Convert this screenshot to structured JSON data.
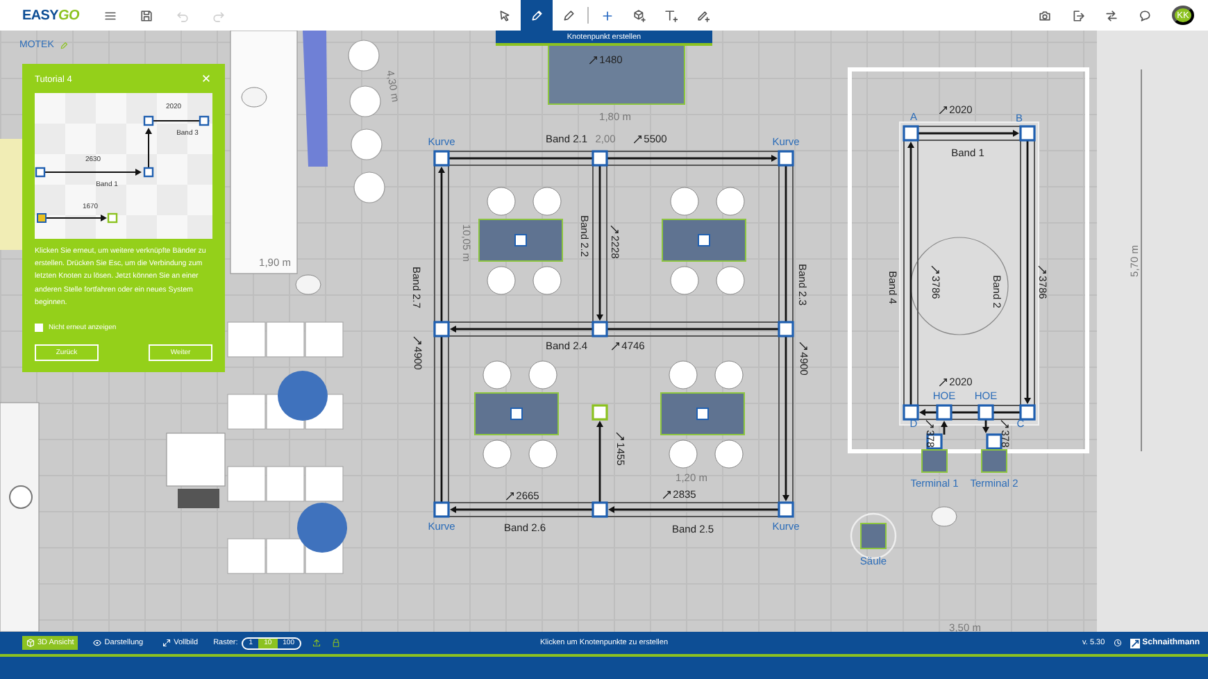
{
  "toolbar": {
    "logo": [
      "EASY",
      "GO"
    ],
    "history": [
      {
        "kind": "undo",
        "disabled": true
      },
      {
        "kind": "redo",
        "disabled": true
      }
    ],
    "tools": [
      {
        "kind": "select",
        "selected": false
      },
      {
        "kind": "draw",
        "selected": true
      },
      {
        "kind": "edit",
        "selected": false
      },
      {
        "kind": "add_node",
        "selected": false
      },
      {
        "kind": "add_object",
        "selected": false
      },
      {
        "kind": "add_text",
        "selected": false
      },
      {
        "kind": "add_dimension",
        "selected": false
      }
    ],
    "tooltip": "Knotenpunkt erstellen",
    "actions": [
      {
        "kind": "camera"
      },
      {
        "kind": "export"
      },
      {
        "kind": "switch"
      },
      {
        "kind": "chat"
      }
    ],
    "user": {
      "initials": "KK"
    }
  },
  "canvas": {
    "project": "MOTEK",
    "labels": [
      {
        "text": "4,30 m",
        "kind": "dimension"
      },
      {
        "text": "1480",
        "kind": "length"
      },
      {
        "text": "1,80 m",
        "kind": "dimension"
      },
      {
        "text": "Kurve",
        "kind": "node"
      },
      {
        "text": "Band 2.1",
        "kind": "band"
      },
      {
        "text": "2,00",
        "kind": "dimension"
      },
      {
        "text": "5500",
        "kind": "length"
      },
      {
        "text": "Kurve",
        "kind": "node"
      },
      {
        "text": "10,05 m",
        "kind": "dimension"
      },
      {
        "text": "Band 2.2",
        "kind": "band"
      },
      {
        "text": "2228",
        "kind": "length"
      },
      {
        "text": "Band 2.3",
        "kind": "band"
      },
      {
        "text": "Band 2.7",
        "kind": "band"
      },
      {
        "text": "4900",
        "kind": "length"
      },
      {
        "text": "4900",
        "kind": "length"
      },
      {
        "text": "Band 2.4",
        "kind": "band"
      },
      {
        "text": "4746",
        "kind": "length"
      },
      {
        "text": "1,90 m",
        "kind": "dimension"
      },
      {
        "text": "1455",
        "kind": "length"
      },
      {
        "text": "1,20 m",
        "kind": "dimension"
      },
      {
        "text": "2665",
        "kind": "length"
      },
      {
        "text": "2835",
        "kind": "length"
      },
      {
        "text": "Kurve",
        "kind": "node"
      },
      {
        "text": "Band 2.6",
        "kind": "band"
      },
      {
        "text": "Band 2.5",
        "kind": "band"
      },
      {
        "text": "Kurve",
        "kind": "node"
      },
      {
        "text": "A",
        "kind": "node"
      },
      {
        "text": "2020",
        "kind": "length"
      },
      {
        "text": "B",
        "kind": "node"
      },
      {
        "text": "Band 1",
        "kind": "band"
      },
      {
        "text": "Band 4",
        "kind": "band"
      },
      {
        "text": "3786",
        "kind": "length"
      },
      {
        "text": "Band 2",
        "kind": "band"
      },
      {
        "text": "3786",
        "kind": "length"
      },
      {
        "text": "5,70 m",
        "kind": "dimension"
      },
      {
        "text": "2020",
        "kind": "length"
      },
      {
        "text": "HOE",
        "kind": "node"
      },
      {
        "text": "HOE",
        "kind": "node"
      },
      {
        "text": "D",
        "kind": "node"
      },
      {
        "text": "C",
        "kind": "node"
      },
      {
        "text": "378",
        "kind": "length"
      },
      {
        "text": "378",
        "kind": "length"
      },
      {
        "text": "Terminal 1",
        "kind": "object"
      },
      {
        "text": "Terminal 2",
        "kind": "object"
      },
      {
        "text": "Säule",
        "kind": "object"
      },
      {
        "text": "3,50 m",
        "kind": "dimension"
      }
    ]
  },
  "tutorial": {
    "title": "Tutorial 4",
    "illustration_labels": [
      "2020",
      "Band 3",
      "2630",
      "Band 1",
      "1670"
    ],
    "text": "Klicken Sie erneut, um weitere verknüpfte Bänder zu erstellen. Drücken Sie Esc, um die Verbindung zum letzten Knoten zu lösen. Jetzt können Sie an einer anderen Stelle fortfahren oder ein neues System beginnen.",
    "checkbox": {
      "label": "Nicht erneut anzeigen",
      "checked": false
    },
    "buttons": [
      "Zurück",
      "Weiter"
    ]
  },
  "status_bar": {
    "buttons": [
      {
        "kind": "perspective",
        "label": "3D Ansicht",
        "selected": true
      },
      {
        "kind": "view",
        "label": "Darstellung",
        "selected": false
      },
      {
        "kind": "fullscreen",
        "label": "Vollbild",
        "selected": false
      }
    ],
    "raster": {
      "label": "Raster:",
      "options": [
        {
          "label": "1",
          "selected": false
        },
        {
          "label": "10",
          "selected": true
        },
        {
          "label": "100",
          "selected": false
        }
      ]
    },
    "hint": "Klicken um Knotenpunkte zu erstellen",
    "version": "v. 5.30",
    "brand": "Schnaithmann"
  }
}
